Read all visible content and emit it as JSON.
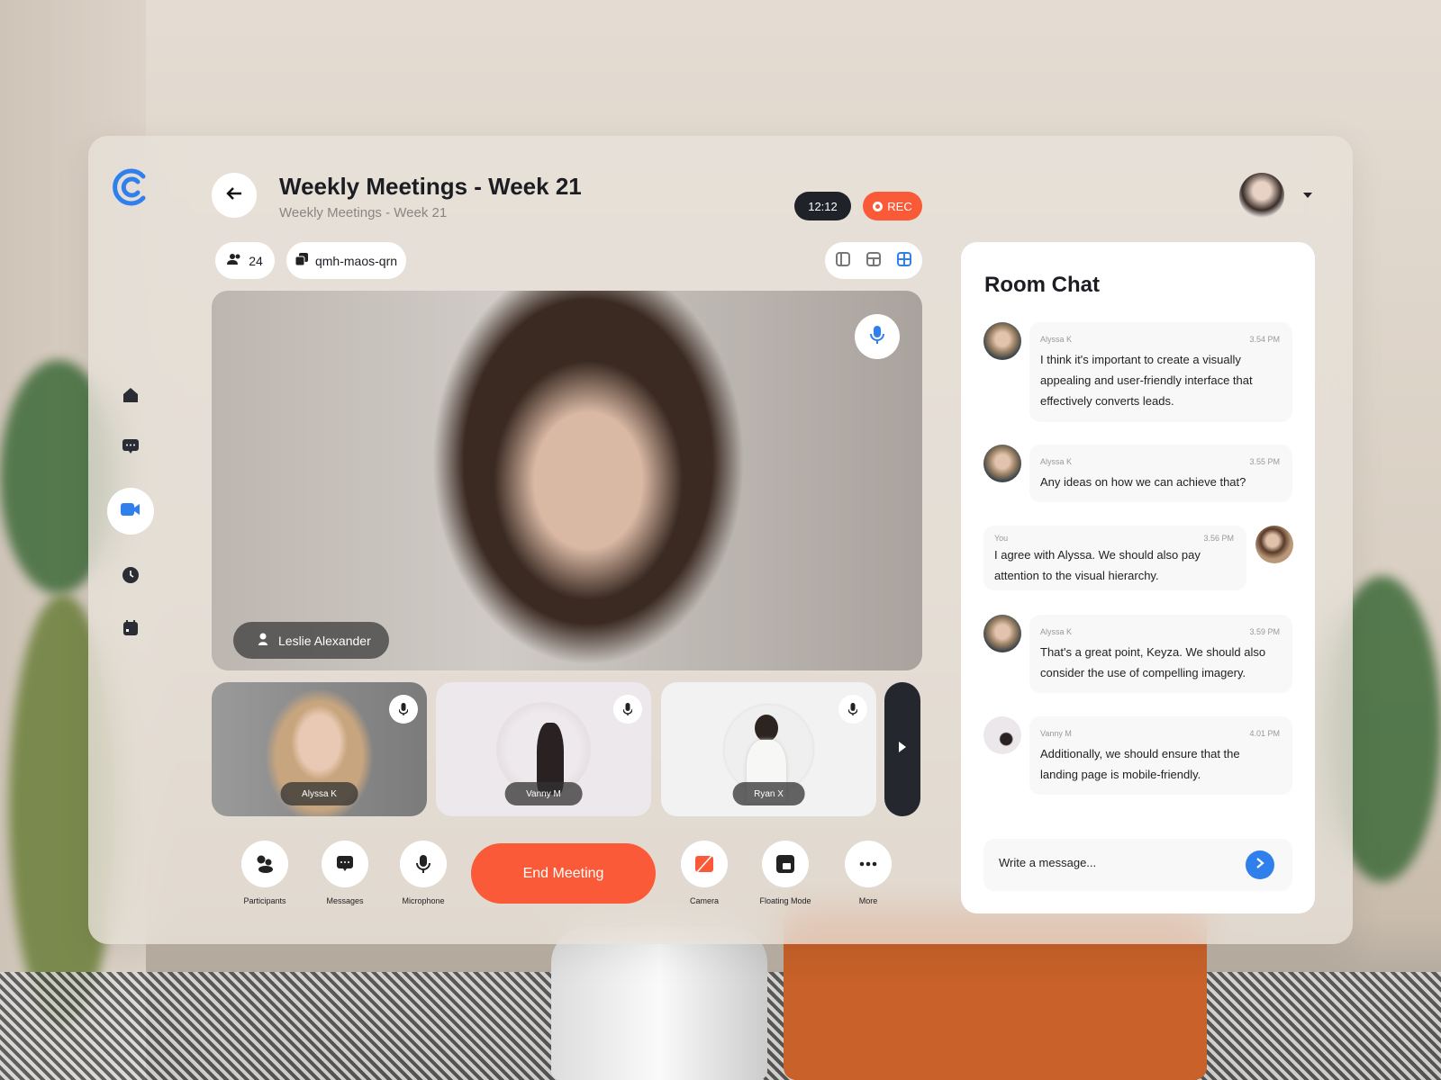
{
  "header": {
    "title": "Weekly Meetings - Week 21",
    "subtitle": "Weekly Meetings - Week 21",
    "timer": "12:12",
    "rec_label": "REC"
  },
  "meeting": {
    "participant_count": "24",
    "room_code": "qmh-maos-qrn"
  },
  "sidebar": {
    "items": [
      {
        "icon": "home-icon"
      },
      {
        "icon": "chat-icon"
      },
      {
        "icon": "video-icon",
        "active": true
      },
      {
        "icon": "clock-icon"
      },
      {
        "icon": "calendar-icon"
      }
    ]
  },
  "main_video": {
    "name": "Leslie Alexander"
  },
  "thumbnails": [
    {
      "name": "Alyssa K"
    },
    {
      "name": "Vanny M"
    },
    {
      "name": "Ryan X"
    }
  ],
  "controls": {
    "participants": "Participants",
    "messages": "Messages",
    "microphone": "Microphone",
    "end": "End Meeting",
    "camera": "Camera",
    "floating": "Floating Mode",
    "more": "More"
  },
  "chat": {
    "title": "Room Chat",
    "placeholder": "Write a message...",
    "messages": [
      {
        "author": "Alyssa K",
        "time": "3.54 PM",
        "text": "I think it's important to create a visually appealing and user-friendly interface that effectively converts leads."
      },
      {
        "author": "Alyssa K",
        "time": "3.55 PM",
        "text": "Any ideas on how we can achieve that?"
      },
      {
        "author": "You",
        "time": "3.56 PM",
        "text": "I agree with Alyssa. We should also pay attention to the visual hierarchy."
      },
      {
        "author": "Alyssa K",
        "time": "3.59 PM",
        "text": "That's a great point, Keyza. We should also consider the use of compelling imagery."
      },
      {
        "author": "Vanny M",
        "time": "4.01 PM",
        "text": "Additionally, we should ensure that the landing page is mobile-friendly."
      }
    ]
  },
  "colors": {
    "accent": "#2f80ed",
    "danger": "#fa5a37",
    "dark": "#1f2228"
  }
}
